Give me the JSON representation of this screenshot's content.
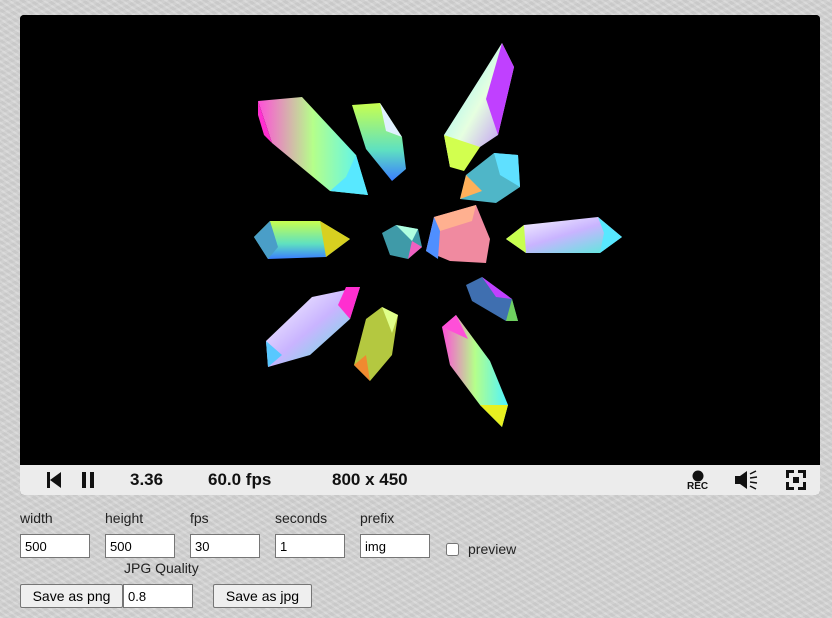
{
  "player": {
    "time": "3.36",
    "fps": "60.0 fps",
    "resolution": "800 x 450",
    "rec_label": "REC",
    "icons": {
      "restart": "skip-back-icon",
      "pause": "pause-icon",
      "record": "record-icon",
      "audio": "speaker-icon",
      "fullscreen": "fullscreen-icon"
    }
  },
  "capture_form": {
    "width": {
      "label": "width",
      "value": "500"
    },
    "height": {
      "label": "height",
      "value": "500"
    },
    "fps": {
      "label": "fps",
      "value": "30"
    },
    "seconds": {
      "label": "seconds",
      "value": "1"
    },
    "prefix": {
      "label": "prefix",
      "value": "img"
    },
    "preview": {
      "label": "preview",
      "checked": false
    },
    "jpg_quality": {
      "label": "JPG Quality",
      "value": "0.8"
    },
    "save_png_label": "Save as png",
    "save_jpg_label": "Save as jpg"
  }
}
